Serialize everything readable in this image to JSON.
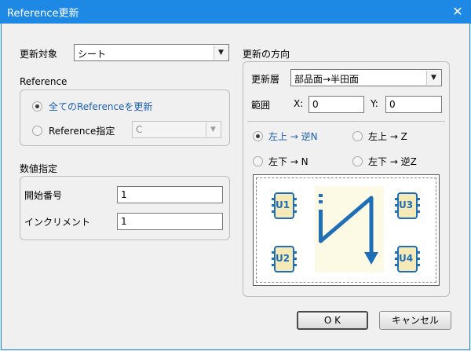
{
  "window": {
    "title": "Reference更新",
    "close_glyph": "✕"
  },
  "target": {
    "label": "更新対象",
    "value": "シート"
  },
  "reference_group": {
    "title": "Reference",
    "option_all": "全てのReferenceを更新",
    "option_specify": "Reference指定",
    "specify_value": "C"
  },
  "numeric_group": {
    "title": "数値指定",
    "start_label": "開始番号",
    "start_value": "1",
    "increment_label": "インクリメント",
    "increment_value": "1"
  },
  "direction_group": {
    "title": "更新の方向",
    "layer_label": "更新層",
    "layer_value": "部品面→半田面",
    "range_label": "範囲",
    "x_label": "X:",
    "x_value": "0",
    "y_label": "Y:",
    "y_value": "0",
    "opt_topleft_reverse_n": "左上 → 逆N",
    "opt_topleft_z": "左上 → Z",
    "opt_bottomleft_n": "左下 → N",
    "opt_bottomleft_reverse_z": "左下 → 逆Z",
    "preview_chips": [
      "U1",
      "U2",
      "U3",
      "U4"
    ]
  },
  "buttons": {
    "ok": "O K",
    "cancel": "キャンセル"
  },
  "colors": {
    "titlebar": "#1e88e5",
    "selected_text": "#1a5fb4",
    "chip": "#1e6fb8",
    "chip_body": "#f5e9b8"
  }
}
